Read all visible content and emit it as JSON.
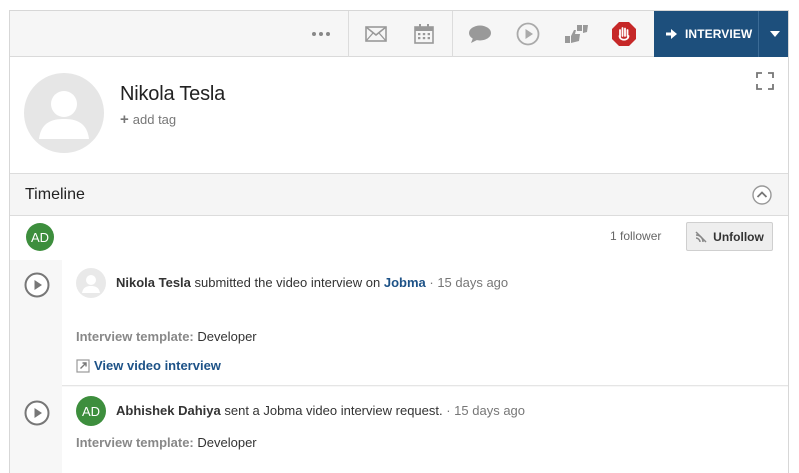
{
  "toolbar": {
    "icons": [
      "more-icon",
      "mail-icon",
      "calendar-icon",
      "chat-icon",
      "play-icon",
      "thumbs-icon",
      "stop-icon"
    ],
    "interview_label": "INTERVIEW",
    "accent": "#1d4f7c",
    "stop_color": "#c62828"
  },
  "profile": {
    "name": "Nikola Tesla",
    "add_tag_label": "add tag"
  },
  "timeline": {
    "title": "Timeline",
    "follower_initials": "AD",
    "follower_count": "1 follower",
    "unfollow_label": "Unfollow",
    "items": [
      {
        "actor": "Nikola Tesla",
        "action": " submitted the video interview on ",
        "link": "Jobma",
        "sep": " · ",
        "ago": "15 days ago",
        "template_label": "Interview template:",
        "template_value": " Developer",
        "view_label": "View video interview"
      },
      {
        "initials": "AD",
        "actor": "Abhishek Dahiya",
        "action": " sent a Jobma video interview request.",
        "sep": " · ",
        "ago": "15 days ago",
        "template_label": "Interview template:",
        "template_value": " Developer"
      }
    ]
  }
}
